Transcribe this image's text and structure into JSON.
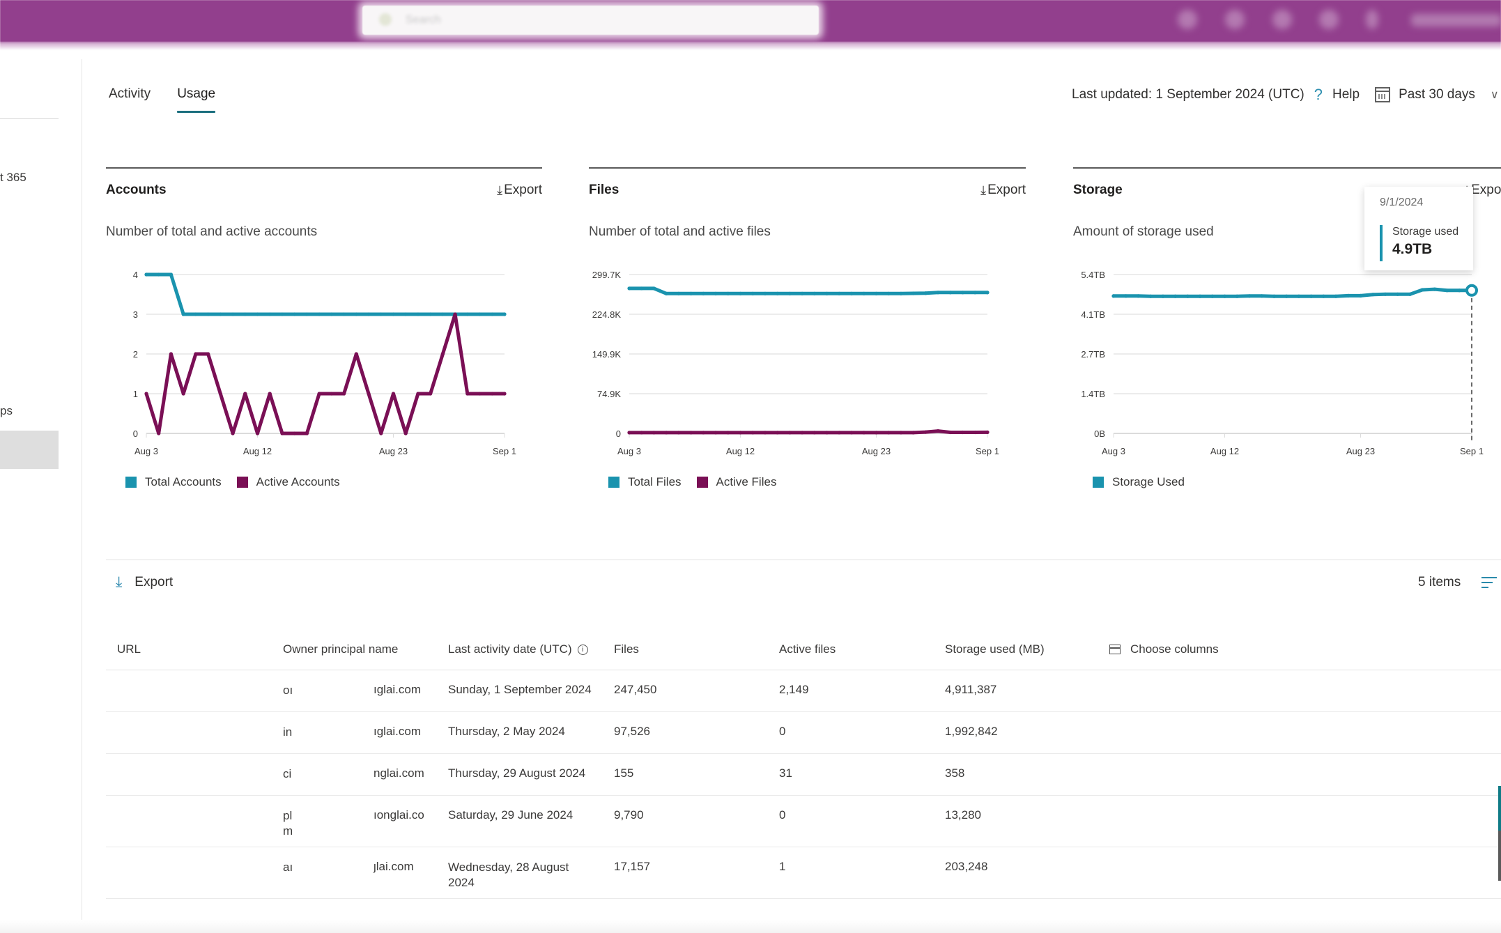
{
  "topbar": {
    "search_placeholder": "Search",
    "icons": [
      "app-icon",
      "notifications-icon",
      "settings-icon",
      "help-icon",
      "feedback-icon"
    ],
    "brand_color": "#923f8d"
  },
  "sidebar": {
    "items": [
      {
        "label": "t 365"
      },
      {
        "label": "ps"
      }
    ]
  },
  "tabs": [
    {
      "label": "Activity",
      "active": false
    },
    {
      "label": "Usage",
      "active": true
    }
  ],
  "header": {
    "last_updated": "Last updated: 1 September 2024 (UTC)",
    "help": "Help",
    "period": "Past 30 days"
  },
  "colors": {
    "total": "#1a93ae",
    "active": "#7a0f55",
    "accent": "#1c6f7f"
  },
  "cards": [
    {
      "title": "Accounts",
      "export": "Export",
      "subtitle": "Number of total and active accounts"
    },
    {
      "title": "Files",
      "export": "Export",
      "subtitle": "Number of total and active files"
    },
    {
      "title": "Storage",
      "export": "Export",
      "subtitle": "Amount of storage used"
    }
  ],
  "tooltip": {
    "date": "9/1/2024",
    "label": "Storage used",
    "value": "4.9TB"
  },
  "chart_data": [
    {
      "type": "line",
      "title": "Accounts",
      "subtitle": "Number of total and active accounts",
      "x_start": "Aug 3",
      "x_end": "Sep 1",
      "x_ticks": [
        "Aug 3",
        "Aug 12",
        "Aug 23",
        "Sep 1"
      ],
      "x_tick_index": [
        0,
        9,
        20,
        29
      ],
      "y_ticks": [
        "0",
        "1",
        "2",
        "3",
        "4"
      ],
      "ylim": [
        0,
        4
      ],
      "grid": true,
      "legend": "bottom-left",
      "series": [
        {
          "name": "Total Accounts",
          "values": [
            4,
            4,
            4,
            3,
            3,
            3,
            3,
            3,
            3,
            3,
            3,
            3,
            3,
            3,
            3,
            3,
            3,
            3,
            3,
            3,
            3,
            3,
            3,
            3,
            3,
            3,
            3,
            3,
            3,
            3
          ]
        },
        {
          "name": "Active Accounts",
          "values": [
            1,
            0,
            2,
            1,
            2,
            2,
            1,
            0,
            1,
            0,
            1,
            0,
            0,
            0,
            1,
            1,
            1,
            2,
            1,
            0,
            1,
            0,
            1,
            1,
            2,
            3,
            1,
            1,
            1,
            1
          ]
        }
      ]
    },
    {
      "type": "line",
      "title": "Files",
      "subtitle": "Number of total and active files",
      "x_start": "Aug 3",
      "x_end": "Sep 1",
      "x_ticks": [
        "Aug 3",
        "Aug 12",
        "Aug 23",
        "Sep 1"
      ],
      "x_tick_index": [
        0,
        9,
        20,
        29
      ],
      "y_ticks": [
        "0",
        "74.9K",
        "149.9K",
        "224.8K",
        "299.7K"
      ],
      "ylim": [
        0,
        299700
      ],
      "grid": true,
      "legend": "bottom-left",
      "series": [
        {
          "name": "Total Files",
          "values": [
            273500,
            273500,
            273500,
            263800,
            263800,
            263800,
            263800,
            263800,
            263800,
            263800,
            263800,
            263800,
            263800,
            263800,
            263800,
            263800,
            263800,
            263800,
            263800,
            263800,
            263800,
            263800,
            263800,
            264200,
            264500,
            265800,
            265800,
            265800,
            265800,
            265800
          ]
        },
        {
          "name": "Active Files",
          "values": [
            1500,
            1500,
            1500,
            1500,
            1500,
            1500,
            1500,
            1500,
            1500,
            1500,
            1500,
            1500,
            1500,
            1500,
            1500,
            1500,
            1500,
            1500,
            1500,
            1500,
            1500,
            1500,
            1500,
            1500,
            2500,
            4500,
            2000,
            2000,
            2000,
            2149
          ]
        }
      ]
    },
    {
      "type": "line",
      "title": "Storage",
      "subtitle": "Amount of storage used",
      "x_start": "Aug 3",
      "x_end": "Sep 1",
      "x_ticks": [
        "Aug 3",
        "Aug 12",
        "Aug 23",
        "Sep 1"
      ],
      "x_tick_index": [
        0,
        9,
        20,
        29
      ],
      "y_ticks": [
        "0B",
        "1.4TB",
        "2.7TB",
        "4.1TB",
        "5.4TB"
      ],
      "ylim": [
        0,
        5.4
      ],
      "y_unit": "TB",
      "grid": true,
      "legend": "bottom-left",
      "highlight_index": 29,
      "series": [
        {
          "name": "Storage Used",
          "values": [
            4.67,
            4.67,
            4.67,
            4.66,
            4.66,
            4.66,
            4.66,
            4.66,
            4.66,
            4.66,
            4.66,
            4.67,
            4.67,
            4.66,
            4.66,
            4.66,
            4.66,
            4.66,
            4.66,
            4.68,
            4.68,
            4.72,
            4.73,
            4.73,
            4.73,
            4.88,
            4.9,
            4.86,
            4.86,
            4.86
          ]
        }
      ]
    }
  ],
  "table": {
    "export_label": "Export",
    "item_count": "5 items",
    "columns": [
      "URL",
      "Owner principal name",
      "Last activity date (UTC)",
      "Files",
      "Active files",
      "Storage used (MB)",
      "Choose columns"
    ],
    "rows": [
      {
        "url": "",
        "owner_a": "oı",
        "owner_b": "ıglai.com",
        "last_activity": "Sunday, 1 September 2024",
        "files": "247,450",
        "active_files": "2,149",
        "storage_mb": "4,911,387"
      },
      {
        "url": "",
        "owner_a": "in",
        "owner_b": "ıglai.com",
        "last_activity": "Thursday, 2 May 2024",
        "files": "97,526",
        "active_files": "0",
        "storage_mb": "1,992,842"
      },
      {
        "url": "",
        "owner_a": "ci",
        "owner_b": "nglai.com",
        "last_activity": "Thursday, 29 August 2024",
        "files": "155",
        "active_files": "31",
        "storage_mb": "358"
      },
      {
        "url": "",
        "owner_a": "pl\nm",
        "owner_b": "ıonglai.co",
        "last_activity": "Saturday, 29 June 2024",
        "files": "9,790",
        "active_files": "0",
        "storage_mb": "13,280"
      },
      {
        "url": "",
        "owner_a": "aı",
        "owner_b": "ȷlai.com",
        "last_activity": "Wednesday, 28 August 2024",
        "files": "17,157",
        "active_files": "1",
        "storage_mb": "203,248"
      }
    ]
  }
}
